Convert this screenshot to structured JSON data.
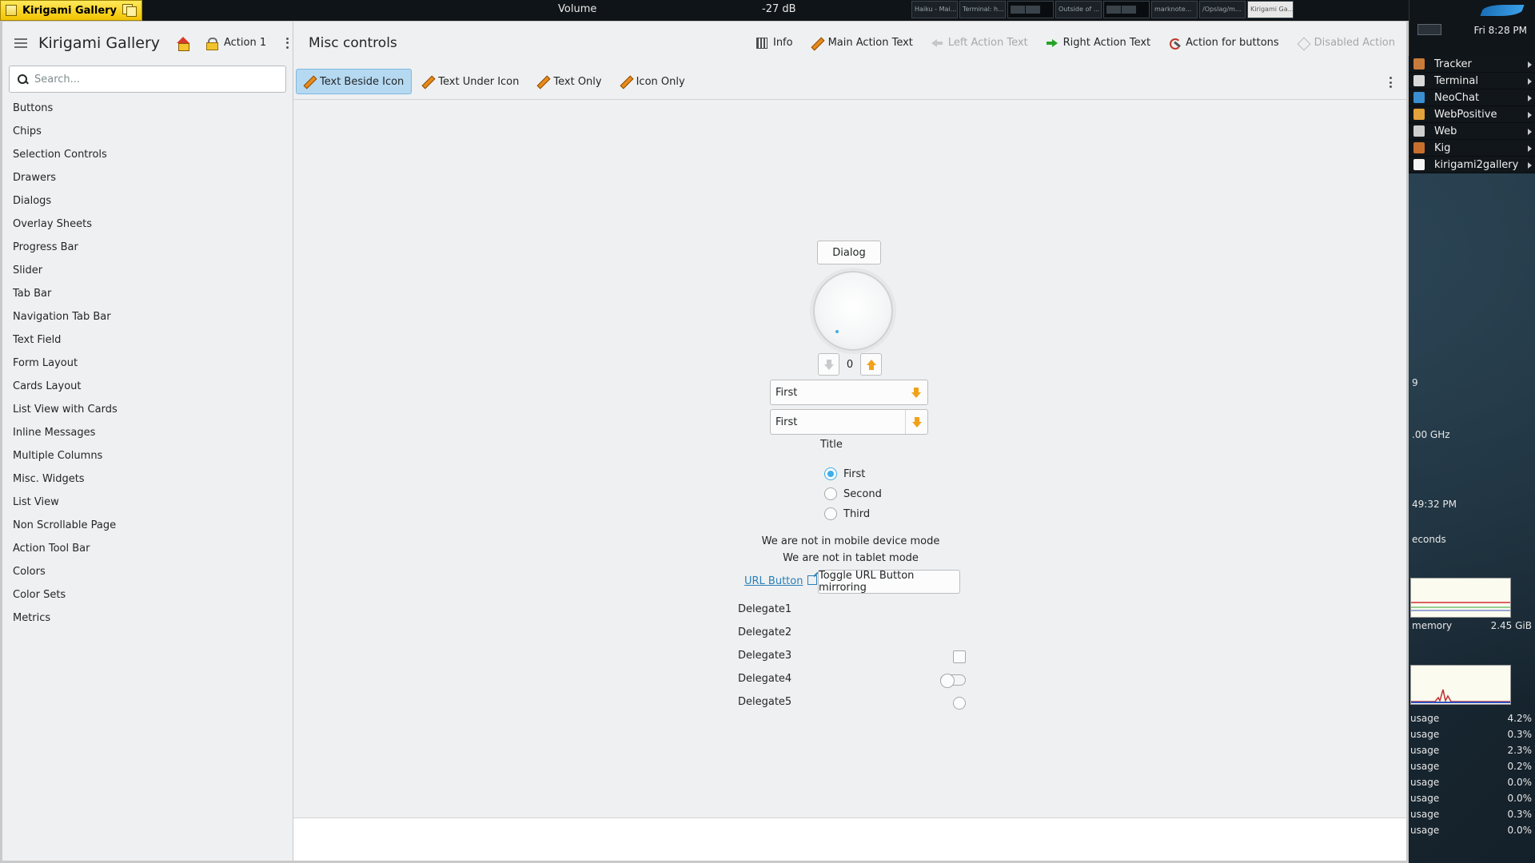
{
  "window_tab": {
    "title": "Kirigami Gallery"
  },
  "topbar": {
    "volume_label": "Volume",
    "volume_value": "-27 dB",
    "tasks": [
      "Haiku - Mai...",
      "Terminal: h...",
      "",
      "Outside of ...",
      "",
      "marknote...",
      "/Opslag/m...",
      "Kirigami Ga..."
    ]
  },
  "sidebar": {
    "title": "Kirigami Gallery",
    "action1": "Action 1",
    "search_placeholder": "Search...",
    "items": [
      "Buttons",
      "Chips",
      "Selection Controls",
      "Drawers",
      "Dialogs",
      "Overlay Sheets",
      "Progress Bar",
      "Slider",
      "Tab Bar",
      "Navigation Tab Bar",
      "Text Field",
      "Form Layout",
      "Cards Layout",
      "List View with Cards",
      "Inline Messages",
      "Multiple Columns",
      "Misc. Widgets",
      "List View",
      "Non Scrollable Page",
      "Action Tool Bar",
      "Colors",
      "Color Sets",
      "Metrics"
    ]
  },
  "content": {
    "page_title": "Misc controls",
    "header_actions": {
      "info": "Info",
      "main": "Main Action Text",
      "left": "Left Action Text",
      "right": "Right Action Text",
      "buttons": "Action for buttons",
      "disabled": "Disabled Action"
    },
    "toolbar": {
      "beside": "Text Beside Icon",
      "under": "Text Under Icon",
      "text_only": "Text Only",
      "icon_only": "Icon Only"
    },
    "dialog_button": "Dialog",
    "spin_value": "0",
    "combo1": "First",
    "combo2": "First",
    "group_title": "Title",
    "radios": [
      "First",
      "Second",
      "Third"
    ],
    "mobile_text": "We are not in mobile device mode",
    "tablet_text": "We are not in tablet mode",
    "url_button": "URL Button",
    "toggle_button": "Toggle URL Button mirroring",
    "delegates": [
      "Delegate1",
      "Delegate2",
      "Delegate3",
      "Delegate4",
      "Delegate5"
    ]
  },
  "deskbar": {
    "clock": "Fri 8:28 PM",
    "apps": [
      "Tracker",
      "Terminal",
      "NeoChat",
      "WebPositive",
      "Web",
      "Kig",
      "kirigami2gallery"
    ],
    "app_colors": [
      "#c97b3a",
      "#d9d9d9",
      "#3a8fd0",
      "#e3a23a",
      "#cfcfcf",
      "#c86f2e",
      "#f5f5f5"
    ]
  },
  "pulse": {
    "r1": "9",
    "r2": ".00 GHz",
    "r3": "49:32 PM",
    "r4": "econds",
    "memory_label": "memory",
    "memory_value": "2.45 GiB",
    "usages": [
      {
        "label": "usage",
        "value": "4.2%"
      },
      {
        "label": "usage",
        "value": "0.3%"
      },
      {
        "label": "usage",
        "value": "2.3%"
      },
      {
        "label": "usage",
        "value": "0.2%"
      },
      {
        "label": "usage",
        "value": "0.0%"
      },
      {
        "label": "usage",
        "value": "0.0%"
      },
      {
        "label": "usage",
        "value": "0.3%"
      },
      {
        "label": "usage",
        "value": "0.0%"
      }
    ]
  },
  "colors": {
    "accent": "#3daee9",
    "window_tab": "#f2c400",
    "background": "#eff0f1"
  }
}
